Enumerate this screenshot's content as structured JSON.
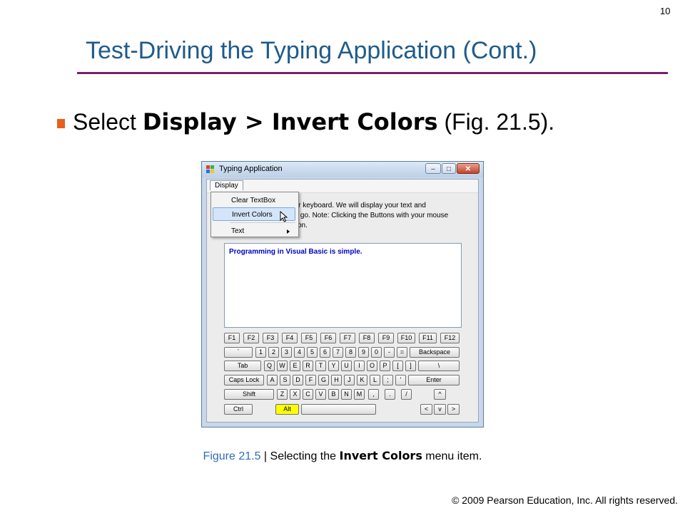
{
  "slide": {
    "page_number": "10",
    "title": "Test-Driving the Typing Application (Cont.)",
    "bullet_prefix": "Select ",
    "bullet_bold": "Display > Invert Colors",
    "bullet_suffix": " (Fig. 21.5).",
    "caption_fig": "Figure 21.5",
    "caption_sep": " | Selecting the ",
    "caption_bold": "Invert Colors",
    "caption_suffix": " menu item.",
    "footer": "© 2009 Pearson Education, Inc.  All rights reserved.",
    "colors": {
      "title": "#1f5b8a",
      "rule": "#7b1e6a",
      "bullet": "#e8601c",
      "caption_fig": "#2e6fb7"
    }
  },
  "window": {
    "title": "Typing Application",
    "min_label": "–",
    "max_label": "□",
    "close_label": "✕",
    "menu": {
      "display_label": "Display"
    },
    "dropdown": {
      "items": [
        {
          "label": "Clear TextBox"
        },
        {
          "label": "Invert Colors"
        },
        {
          "label": "Text"
        }
      ]
    },
    "description_lines": [
      "our keyboard. We will display your text and",
      "ou go. Note: Clicking the Buttons with your mouse",
      "ction."
    ],
    "textbox_value": "Programming in Visual Basic is simple.",
    "keyboard": {
      "row1": [
        "F1",
        "F2",
        "F3",
        "F4",
        "F5",
        "F6",
        "F7",
        "F8",
        "F9",
        "F10",
        "F11",
        "F12"
      ],
      "row2": [
        "`",
        "1",
        "2",
        "3",
        "4",
        "5",
        "6",
        "7",
        "8",
        "9",
        "0",
        "-",
        "=",
        "Backspace"
      ],
      "row3": [
        "Tab",
        "Q",
        "W",
        "E",
        "R",
        "T",
        "Y",
        "U",
        "I",
        "O",
        "P",
        "[",
        "]",
        "\\"
      ],
      "row4": [
        "Caps Lock",
        "A",
        "S",
        "D",
        "F",
        "G",
        "H",
        "J",
        "K",
        "L",
        ";",
        "'",
        "Enter"
      ],
      "row5": [
        "Shift",
        "Z",
        "X",
        "C",
        "V",
        "B",
        "N",
        "M",
        ",",
        ".",
        "/",
        "^"
      ],
      "row6": [
        "Ctrl",
        "Alt",
        "",
        "<",
        "v",
        ">"
      ]
    }
  }
}
